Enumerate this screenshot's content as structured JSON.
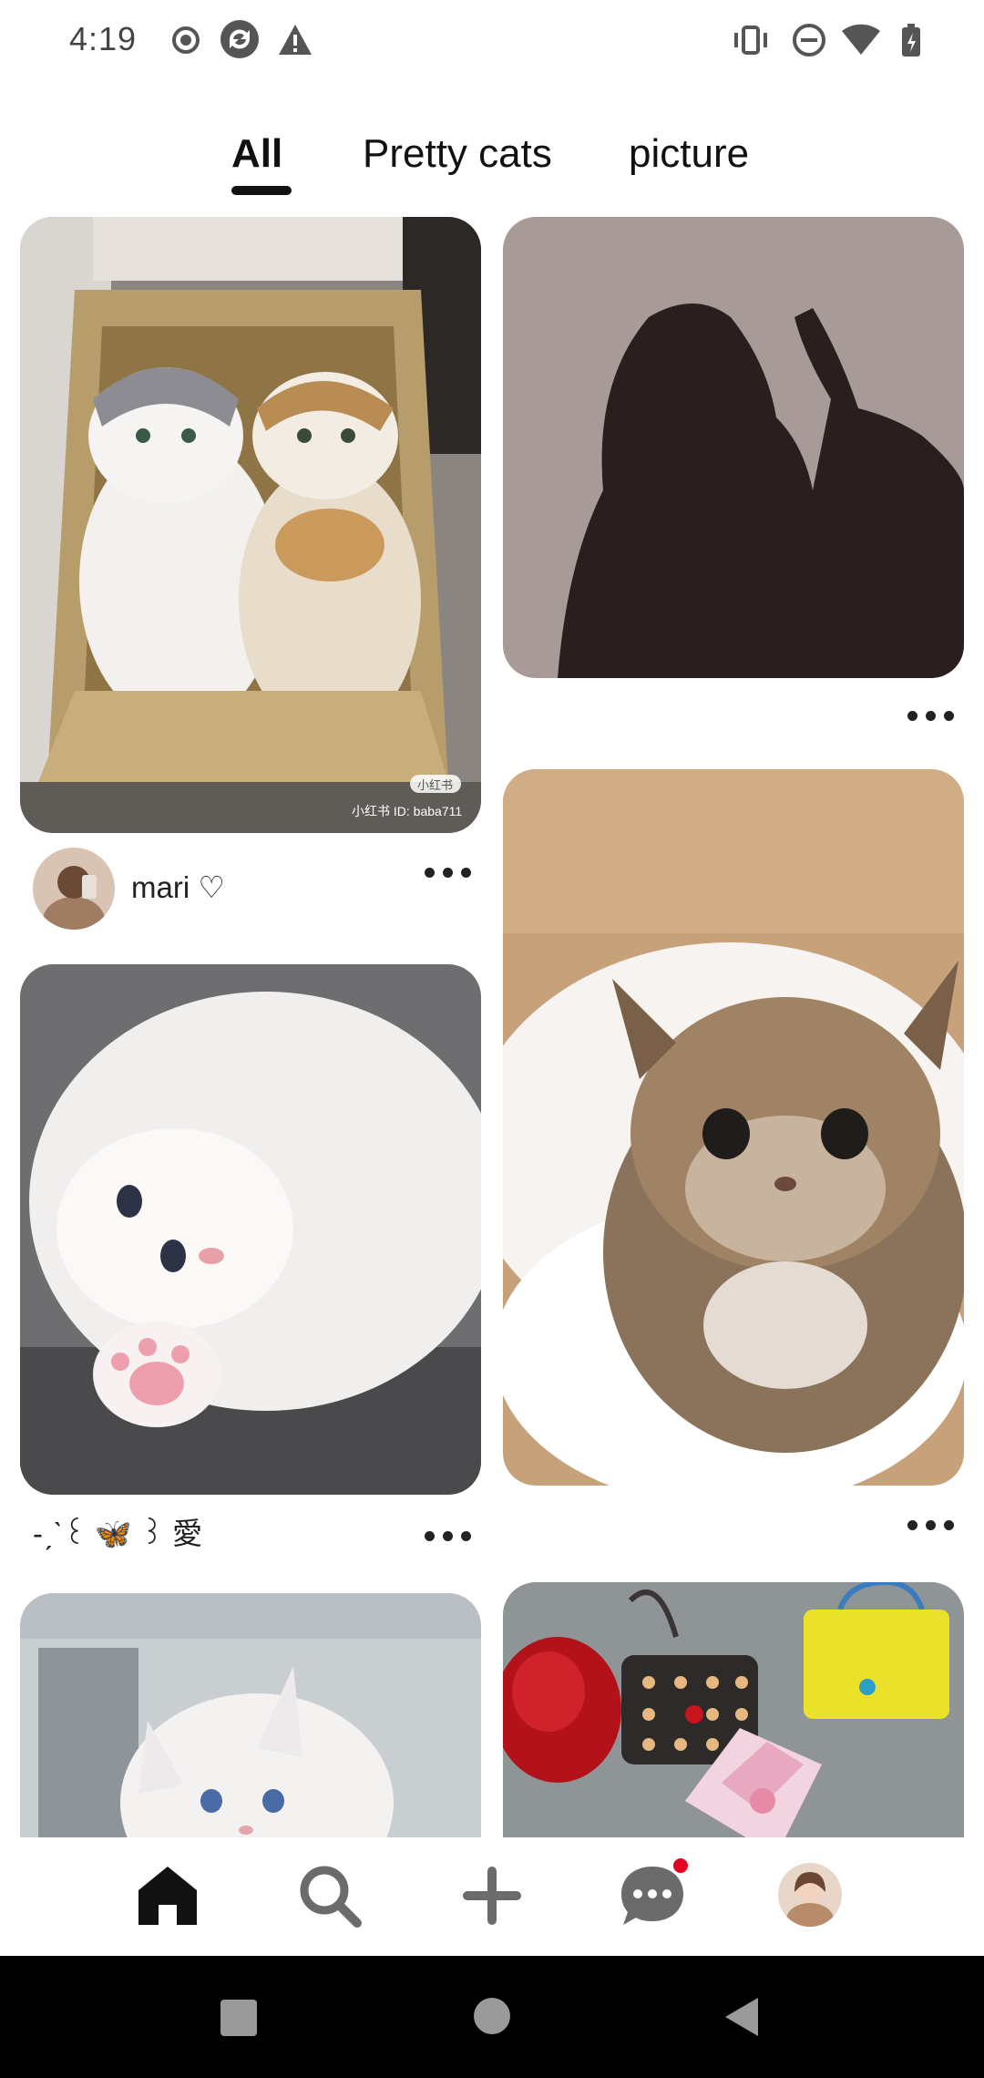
{
  "status_bar": {
    "time": "4:19",
    "left_icons": [
      "record-icon",
      "sync-icon",
      "warning-icon"
    ],
    "right_icons": [
      "vibrate-icon",
      "do-not-disturb-icon",
      "wifi-icon",
      "battery-icon"
    ]
  },
  "tabs": [
    {
      "label": "All",
      "active": true
    },
    {
      "label": "Pretty cats",
      "active": false
    },
    {
      "label": "picture",
      "active": false
    }
  ],
  "feed": {
    "pins": [
      {
        "id": "cats-in-box",
        "author": "mari ♡",
        "watermark_badge": "小红书",
        "watermark_text": "小红书 ID: baba711"
      },
      {
        "id": "silhouette",
        "author": ""
      },
      {
        "id": "white-kitten",
        "author": "-ˏˋ꒰ 🦋 ꒱ 愛"
      },
      {
        "id": "brown-kitten",
        "author": ""
      },
      {
        "id": "white-cat-blue-eyes",
        "author": ""
      },
      {
        "id": "bags",
        "author": ""
      }
    ]
  },
  "bottom_nav": {
    "items": [
      "home-icon",
      "search-icon",
      "create-icon",
      "messages-icon",
      "profile-avatar"
    ],
    "active": "home-icon",
    "messages_badge": true
  },
  "colors": {
    "accent": "#e60023",
    "text": "#111111",
    "silhouette_bg": "#a89a96",
    "silhouette_fg": "#2a1e1e"
  }
}
